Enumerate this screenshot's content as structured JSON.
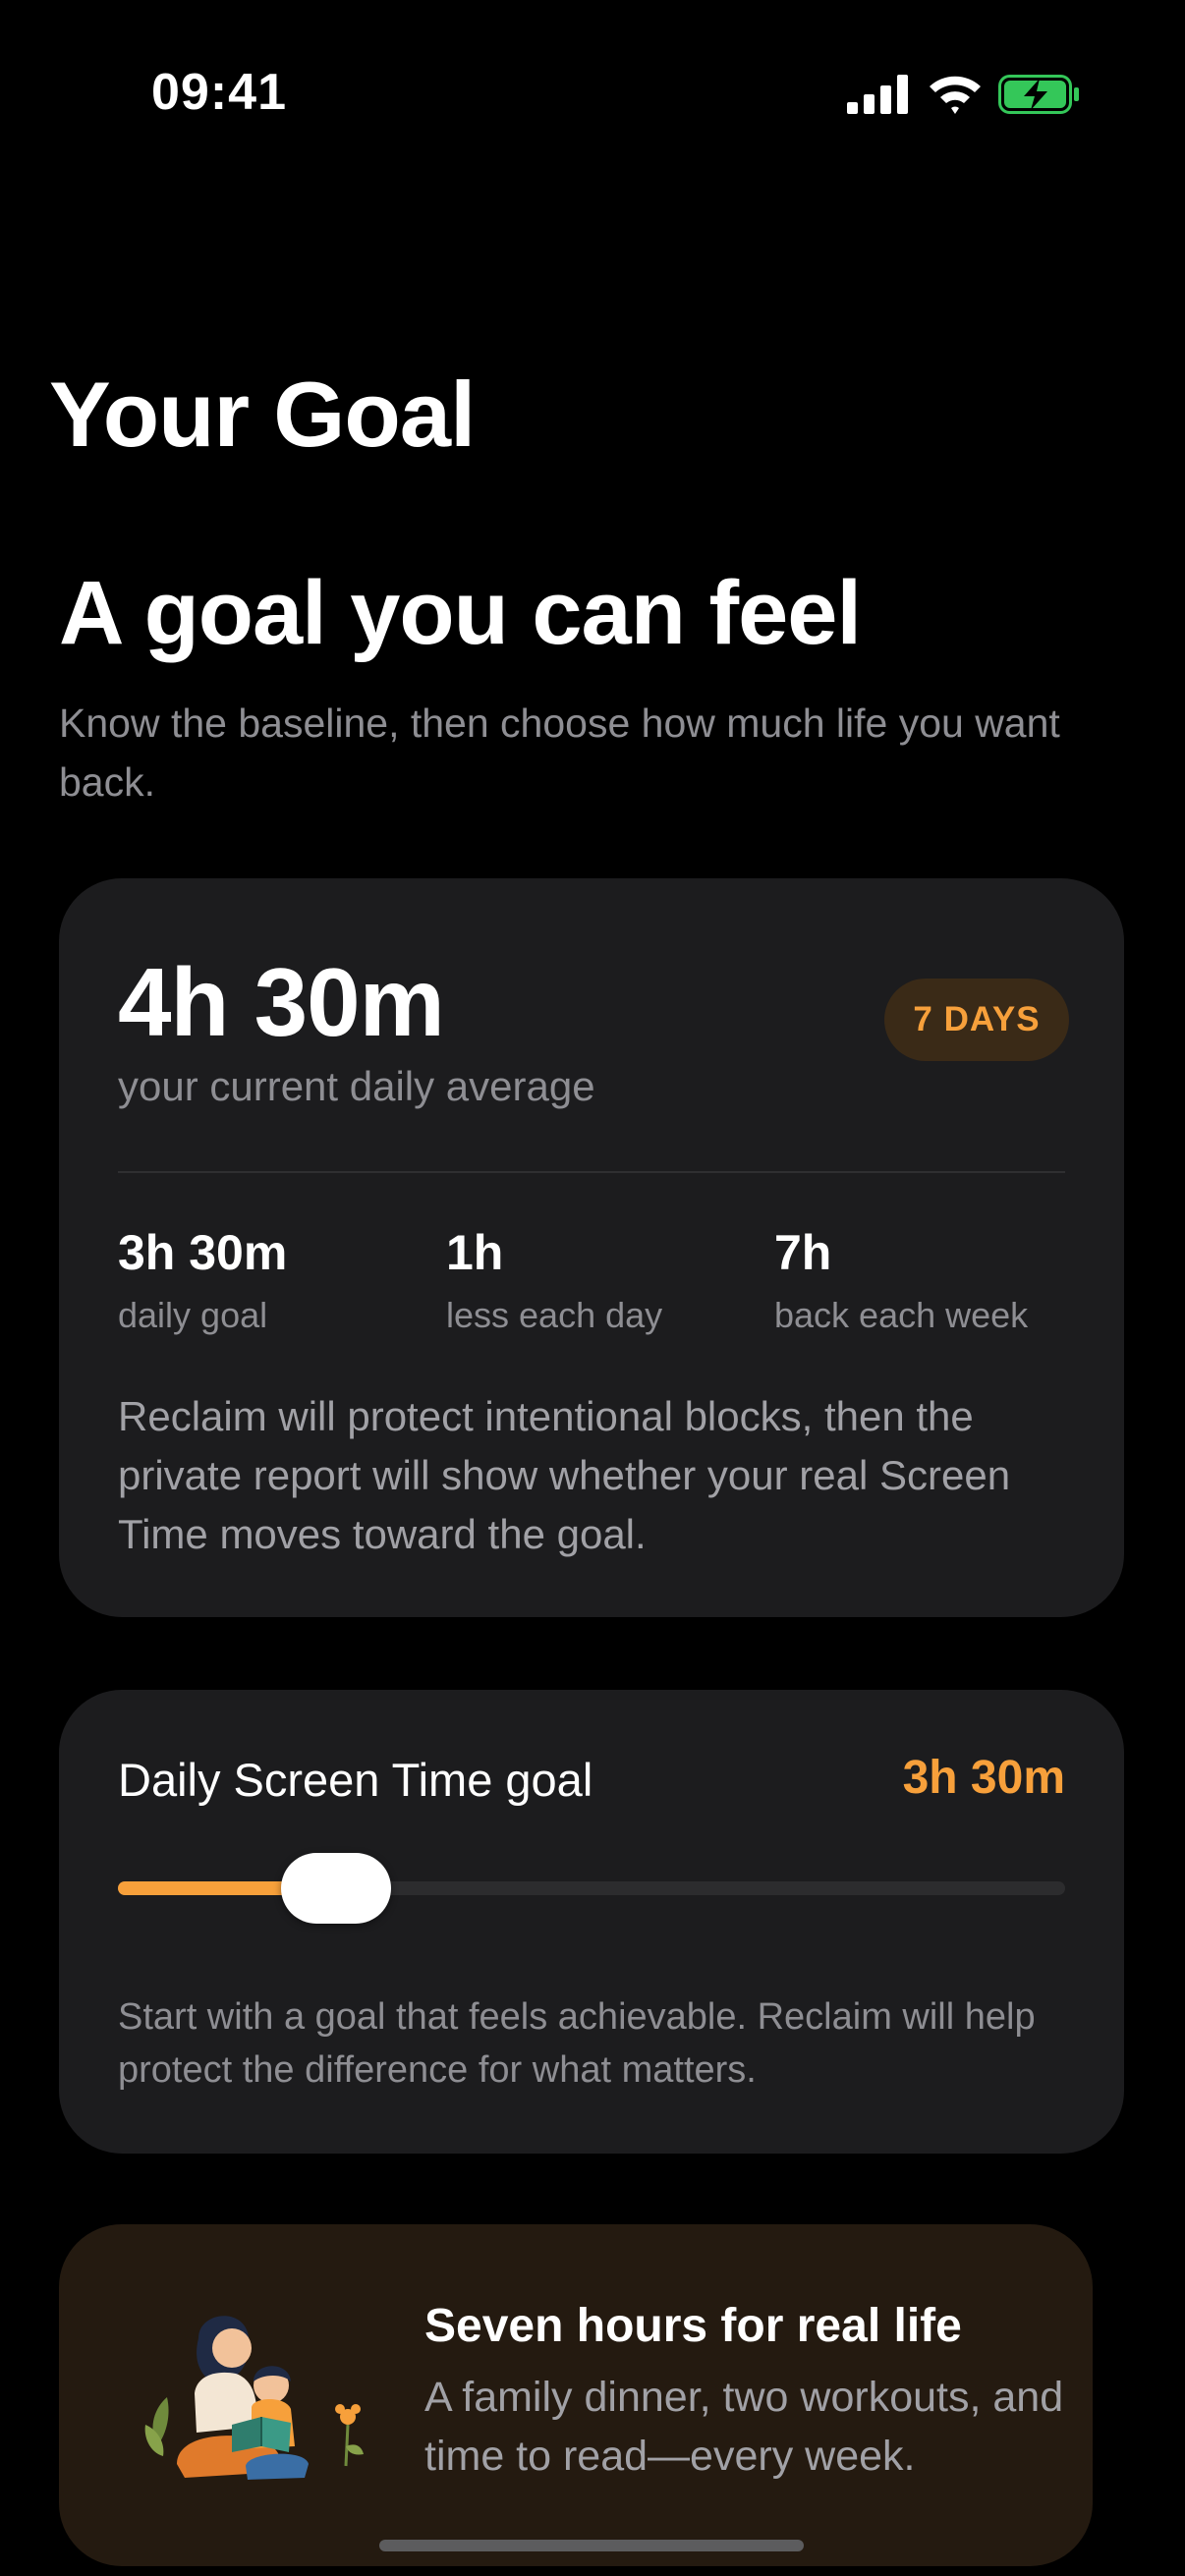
{
  "status_bar": {
    "time": "09:41"
  },
  "screen": {
    "title": "Your Goal"
  },
  "intro": {
    "headline": "A goal you can feel",
    "subtitle": "Know the baseline, then choose how much life you want back."
  },
  "baseline": {
    "value": "4h 30m",
    "caption": "your current daily average",
    "badge": "7 DAYS",
    "stats": [
      {
        "value": "3h 30m",
        "label": "daily goal"
      },
      {
        "value": "1h",
        "label": "less each day"
      },
      {
        "value": "7h",
        "label": "back each week"
      }
    ],
    "note": "Reclaim will protect intentional blocks, then the private report will show whether your real Screen Time moves toward the goal."
  },
  "goal": {
    "label": "Daily Screen Time goal",
    "value": "3h 30m",
    "slider_fraction": 0.23,
    "note": "Start with a goal that feels achievable. Reclaim will help protect the difference for what matters."
  },
  "promo": {
    "title": "Seven hours for real life",
    "text": "A family dinner, two workouts, and time to read—every week."
  },
  "colors": {
    "accent": "#f7a03b",
    "card": "#1c1c1e",
    "promo_card": "#241a10",
    "battery": "#34c759"
  },
  "icons": [
    "cellular-signal-icon",
    "wifi-icon",
    "battery-charging-icon",
    "family-reading-illustration"
  ]
}
